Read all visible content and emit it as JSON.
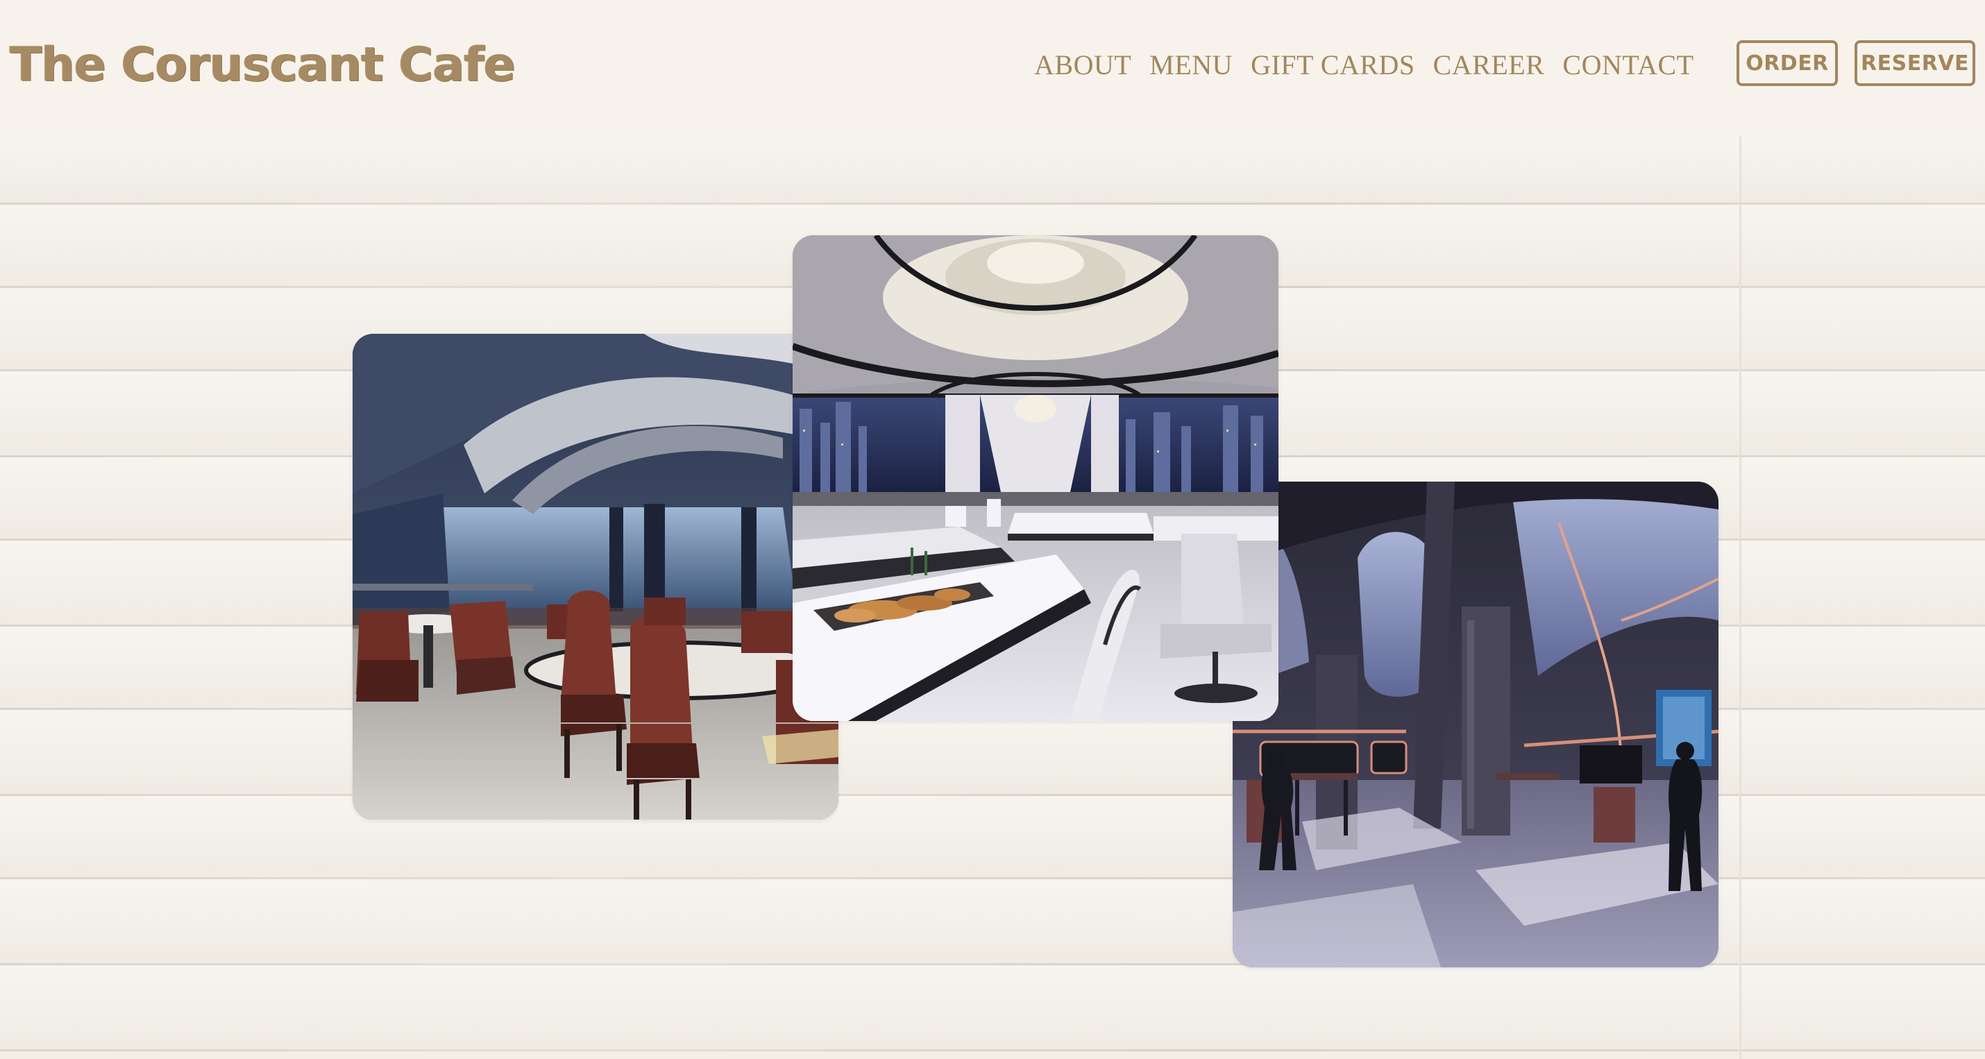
{
  "brand": {
    "name": "The Coruscant Cafe",
    "color": "#a68a63"
  },
  "nav": {
    "links": [
      "ABOUT",
      "MENU",
      "GIFT CARDS",
      "CAREER",
      "CONTACT"
    ],
    "order_label": "ORDER",
    "reserve_label": "RESERVE"
  },
  "gallery": {
    "photos": [
      {
        "name": "dining-room-photo-left",
        "alt": "Futuristic dining room with dark red chairs and panoramic windows"
      },
      {
        "name": "dining-room-photo-center",
        "alt": "Bright white dining hall with city skyline windows and pastry platter"
      },
      {
        "name": "dining-room-photo-right",
        "alt": "Dim sci-fi cafe interior with pillars and diners"
      }
    ]
  },
  "colors": {
    "header_bg": "#f7f3ec",
    "wood_bg": "#f3efe7",
    "accent": "#a3865d"
  }
}
